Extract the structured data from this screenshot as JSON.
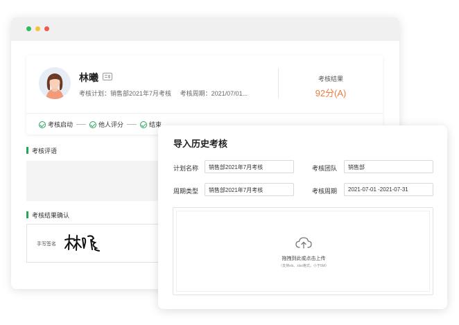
{
  "profile": {
    "name": "林曦",
    "plan_label": "考核计划：",
    "plan_value": "销售部2021年7月考核",
    "period_label": "考核周期：",
    "period_value": "2021/07/01...",
    "result_label": "考核结果",
    "result_value": "92分(A)",
    "result_color": "#f07a3d"
  },
  "steps": [
    {
      "label": "考核启动"
    },
    {
      "label": "他人评分"
    },
    {
      "label": "结束"
    }
  ],
  "sections": {
    "review_title": "考核评语",
    "confirm_title": "考核结果确认",
    "signature_label": "手写签名",
    "signature_name": "林曦"
  },
  "dialog": {
    "title": "导入历史考核",
    "fields": {
      "plan_name_label": "计划名称",
      "plan_name_value": "销售部2021年7月考核",
      "team_label": "考核团队",
      "team_value": "销售部",
      "period_type_label": "周期类型",
      "period_type_value": "销售部2021年7月考核",
      "period_label": "考核周期",
      "period_value": "2021-07-01 -2021-07-31"
    },
    "upload": {
      "icon": "cloud-upload-icon",
      "text": "拖拽到此或点击上传",
      "hint": "（支持xls、xlsx格式，小于5M）"
    }
  },
  "colors": {
    "accent": "#25a55a",
    "window_dots": [
      "#2dbd5a",
      "#f5c33b",
      "#ee5a4e"
    ]
  }
}
